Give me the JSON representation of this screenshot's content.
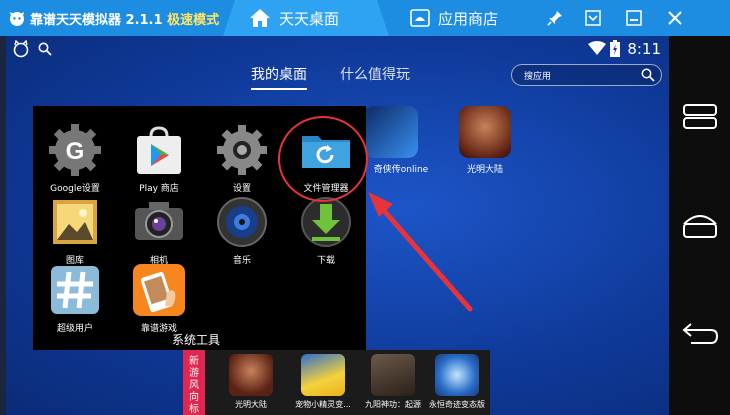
{
  "titlebar": {
    "title": "靠谱天天模拟器 2.1.1",
    "mode": "极速模式",
    "tabs": [
      {
        "label": "天天桌面",
        "icon": "home-icon"
      },
      {
        "label": "应用商店",
        "icon": "android-icon"
      }
    ],
    "controls": [
      "pin-icon",
      "dropdown-icon",
      "minimize-icon",
      "close-icon"
    ]
  },
  "statusbar": {
    "time": "8:11",
    "icons": [
      "wifi-icon",
      "battery-icon"
    ]
  },
  "home": {
    "tabs": [
      "我的桌面",
      "什么值得玩"
    ],
    "search_placeholder": "搜应用",
    "apps": [
      {
        "label": "奇侠传online"
      },
      {
        "label": "光明大陆"
      }
    ]
  },
  "folder": {
    "name": "系统工具",
    "apps": [
      {
        "label": "Google设置",
        "icon": "google-settings-icon"
      },
      {
        "label": "Play 商店",
        "icon": "play-store-icon"
      },
      {
        "label": "设置",
        "icon": "settings-gear-icon"
      },
      {
        "label": "文件管理器",
        "icon": "file-manager-icon"
      },
      {
        "label": "图库",
        "icon": "gallery-icon"
      },
      {
        "label": "相机",
        "icon": "camera-icon"
      },
      {
        "label": "音乐",
        "icon": "music-icon"
      },
      {
        "label": "下载",
        "icon": "download-icon"
      },
      {
        "label": "超级用户",
        "icon": "superuser-icon"
      },
      {
        "label": "靠谱游戏",
        "icon": "kaopu-games-icon"
      }
    ]
  },
  "strip": {
    "tag": "新游风向标",
    "games": [
      {
        "label": "光明大陆"
      },
      {
        "label": "宠物小精灵变..."
      },
      {
        "label": "九阳神功：起源"
      },
      {
        "label": "永恒奇迹变态版"
      }
    ]
  },
  "navbar": {
    "buttons": [
      "menu-icon",
      "home-nav-icon",
      "back-icon"
    ]
  },
  "colors": {
    "titlebar": "#1c8de0",
    "active_tab": "#2ea3f2",
    "mode_text": "#ffe566",
    "annotation": "#e8333a",
    "strip_tag": "#e12650"
  }
}
